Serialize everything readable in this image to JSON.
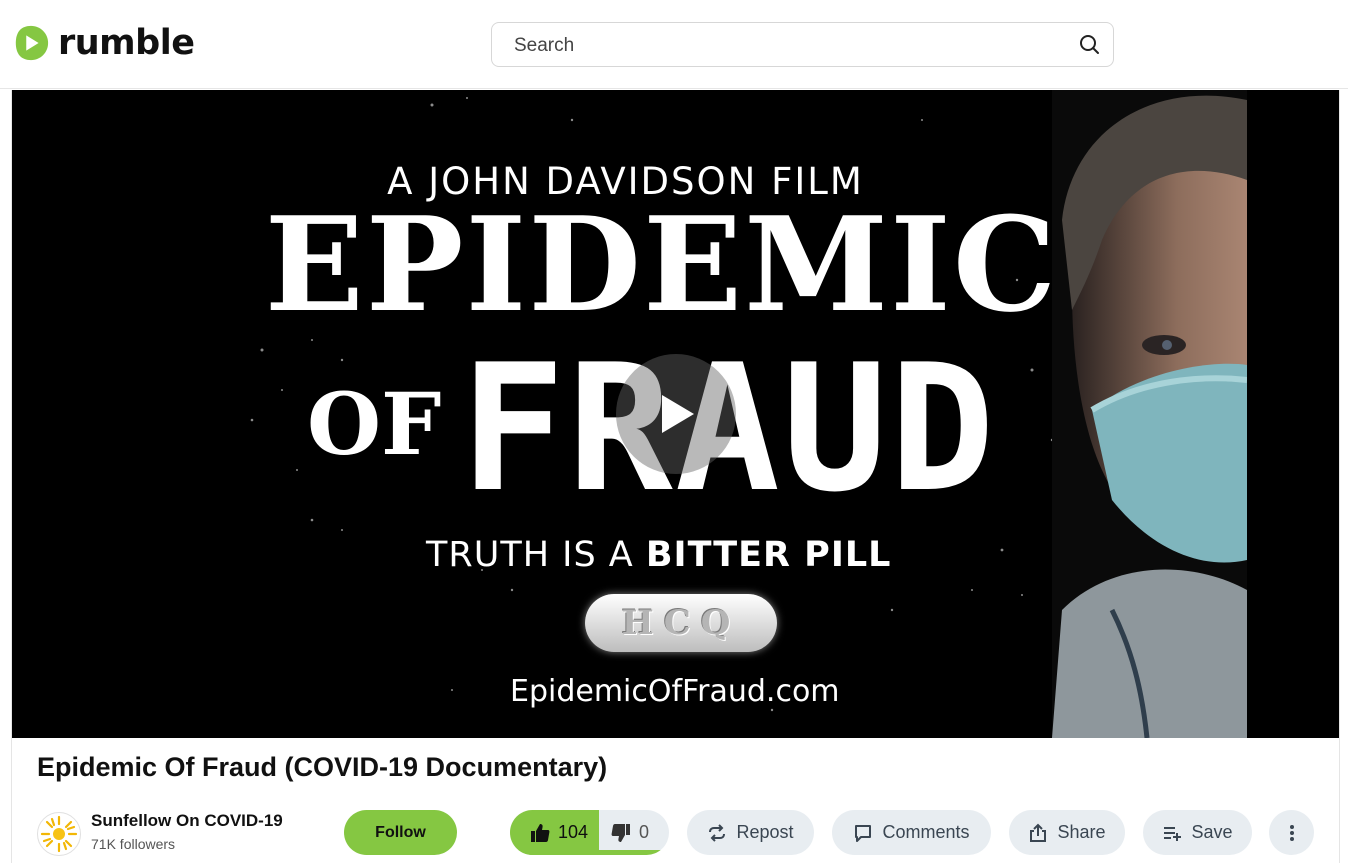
{
  "header": {
    "logo_text": "rumble",
    "search_placeholder": "Search"
  },
  "player": {
    "poster": {
      "credit": "A JOHN DAVIDSON FILM",
      "title_line1": "EPIDEMIC",
      "title_of": "OF",
      "title_fraud": "FRAUD",
      "tagline_plain": "TRUTH IS A ",
      "tagline_bold": "BITTER PILL",
      "pill_text": "HCQ",
      "url": "EpidemicOfFraud.com"
    }
  },
  "video": {
    "title": "Epidemic Of Fraud (COVID-19 Documentary)"
  },
  "channel": {
    "name": "Sunfellow On COVID-19",
    "followers": "71K followers",
    "follow_label": "Follow"
  },
  "actions": {
    "likes": "104",
    "dislikes": "0",
    "repost": "Repost",
    "comments": "Comments",
    "share": "Share",
    "save": "Save"
  },
  "colors": {
    "accent": "#85c742",
    "button_bg": "#e8edf1"
  }
}
